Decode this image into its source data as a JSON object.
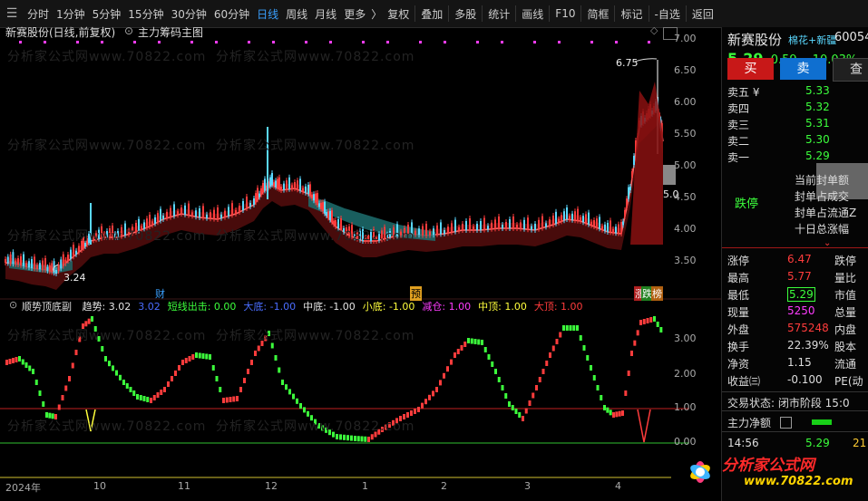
{
  "toolbar": {
    "periods": [
      "分时",
      "1分钟",
      "5分钟",
      "15分钟",
      "30分钟",
      "60分钟",
      "日线",
      "周线",
      "月线",
      "更多"
    ],
    "active_period": "日线",
    "tools": [
      "复权",
      "叠加",
      "多股",
      "统计",
      "画线",
      "F10",
      "简框",
      "标记",
      "-自选",
      "返回"
    ]
  },
  "chart": {
    "title": "新赛股份(日线,前复权)",
    "indicator_main": "主力筹码主图",
    "high_label": "6.75",
    "low_label": "3.24",
    "current_price_tag": "5.0",
    "price_axis": [
      "7.00",
      "6.50",
      "6.00",
      "5.50",
      "5.00",
      "4.50",
      "4.00",
      "3.50"
    ],
    "markers": [
      "财",
      "预",
      "涨",
      "跌",
      "榜"
    ],
    "watermark": "分析家公式网www.70822.com"
  },
  "sub": {
    "name": "顺势顶底副",
    "items": [
      {
        "text": "趋势: 3.02",
        "color": "#e6e6e6"
      },
      {
        "text": "3.02",
        "color": "#4a6dff"
      },
      {
        "text": "短线出击: 0.00",
        "color": "#3cff3c"
      },
      {
        "text": "大底: -1.00",
        "color": "#4a6dff"
      },
      {
        "text": "中底: -1.00",
        "color": "#e6e6e6"
      },
      {
        "text": "小底: -1.00",
        "color": "#ffff3c"
      },
      {
        "text": "减仓: 1.00",
        "color": "#ff3cff"
      },
      {
        "text": "中顶: 1.00",
        "color": "#ffff3c"
      },
      {
        "text": "大顶: 1.00",
        "color": "#ff3c3c"
      }
    ],
    "axis": [
      "3.00",
      "2.00",
      "1.00",
      "0.00"
    ]
  },
  "date_axis": [
    "2024年",
    "10",
    "11",
    "12",
    "1",
    "2",
    "3",
    "4"
  ],
  "quote": {
    "stock_name": "新赛股份",
    "tags": "棉花+新疆",
    "code": "60054",
    "price": "5.29",
    "change": "-0.59",
    "change_pct": "-10.03%",
    "buy_label": "买",
    "sell_label": "卖",
    "query_label": "查",
    "asks": [
      {
        "label": "卖五 ¥",
        "price": "5.33"
      },
      {
        "label": "卖四",
        "price": "5.32"
      },
      {
        "label": "卖三",
        "price": "5.31"
      },
      {
        "label": "卖二",
        "price": "5.30"
      },
      {
        "label": "卖一",
        "price": "5.29"
      }
    ],
    "limit_down_label": "跌停",
    "seal_info": [
      "当前封单额",
      "封单占成交",
      "封单占流通Z",
      "十日总涨幅"
    ],
    "stats": [
      {
        "k": "涨停",
        "v": "6.47",
        "vcolor": "#ff3c3c",
        "k2": "跌停"
      },
      {
        "k": "最高",
        "v": "5.77",
        "vcolor": "#ff3c3c",
        "k2": "量比"
      },
      {
        "k": "最低",
        "v": "5.29",
        "vcolor": "#3cff3c",
        "k2": "市值"
      },
      {
        "k": "现量",
        "v": "5250",
        "vcolor": "#ff3cff",
        "k2": "总量"
      },
      {
        "k": "外盘",
        "v": "575248",
        "vcolor": "#ff3c3c",
        "k2": "内盘"
      },
      {
        "k": "换手",
        "v": "22.39%",
        "vcolor": "#dddddd",
        "k2": "股本"
      },
      {
        "k": "净资",
        "v": "1.15",
        "vcolor": "#dddddd",
        "k2": "流通"
      },
      {
        "k": "收益㈢",
        "v": "-0.100",
        "vcolor": "#dddddd",
        "k2": "PE(动"
      }
    ],
    "trade_status": "交易状态: 闭市阶段 15:0",
    "net_main": "主力净额",
    "tick": {
      "time": "14:56",
      "price": "5.29",
      "vol": "21"
    }
  },
  "logo": {
    "text": "分析家公式网",
    "url": "www.70822.com"
  },
  "colors": {
    "up": "#ff3c3c",
    "down": "#3cff3c",
    "bg": "#000000",
    "accent": "#3aa0ff"
  }
}
